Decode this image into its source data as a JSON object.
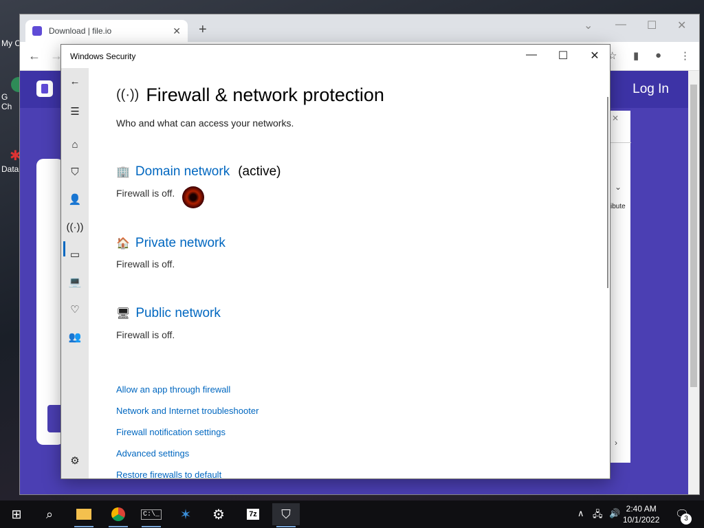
{
  "desktop": {
    "icons": [
      {
        "label": "My C"
      },
      {
        "label": "G\nCh"
      },
      {
        "label": "Data"
      }
    ]
  },
  "browser": {
    "tab_title": "Download | file.io",
    "login_label": "Log In",
    "page_partial_text": "ibute"
  },
  "security": {
    "window_title": "Windows Security",
    "page_title": "Firewall & network protection",
    "subtitle": "Who and what can access your networks.",
    "networks": [
      {
        "name": "Domain network",
        "tag": "(active)",
        "status": "Firewall is off."
      },
      {
        "name": "Private network",
        "tag": "",
        "status": "Firewall is off."
      },
      {
        "name": "Public network",
        "tag": "",
        "status": "Firewall is off."
      }
    ],
    "links": [
      "Allow an app through firewall",
      "Network and Internet troubleshooter",
      "Firewall notification settings",
      "Advanced settings",
      "Restore firewalls to default"
    ],
    "nav_icons": [
      "back-icon",
      "hamburger-icon",
      "home-icon",
      "shield-icon",
      "account-icon",
      "wifi-icon",
      "browser-icon",
      "laptop-icon",
      "heart-icon",
      "family-icon",
      "settings-icon"
    ]
  },
  "taskbar": {
    "time": "2:40 AM",
    "date": "10/1/2022",
    "notification_count": "3",
    "cmd_label": "C:\\_",
    "sevenzip_label": "7z"
  }
}
